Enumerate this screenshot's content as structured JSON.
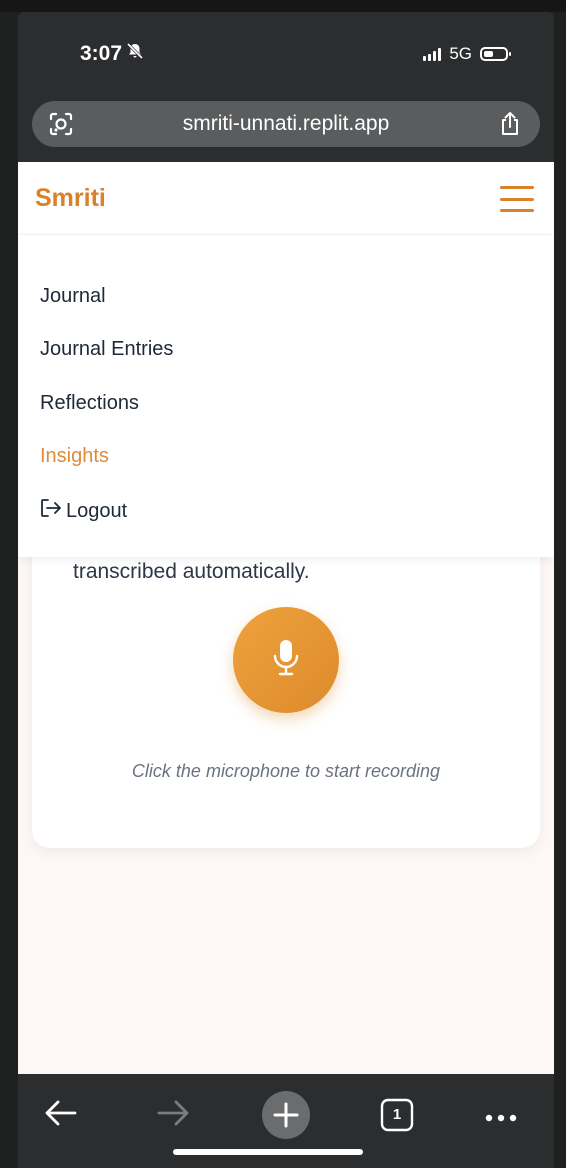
{
  "status_bar": {
    "time": "3:07",
    "network": "5G"
  },
  "browser": {
    "url": "smriti-unnati.replit.app",
    "tab_count": "1"
  },
  "navbar": {
    "brand": "Smriti"
  },
  "menu": {
    "items": [
      {
        "label": "Journal"
      },
      {
        "label": "Journal Entries"
      },
      {
        "label": "Reflections"
      },
      {
        "label": "Insights"
      },
      {
        "label": "Logout"
      }
    ]
  },
  "recorder": {
    "description_tail": "transcribed automatically.",
    "hint": "Click the microphone to start recording"
  },
  "colors": {
    "brand": "#d9822b",
    "active_menu": "#e08a3a",
    "page_bg": "#fdf8f6"
  }
}
